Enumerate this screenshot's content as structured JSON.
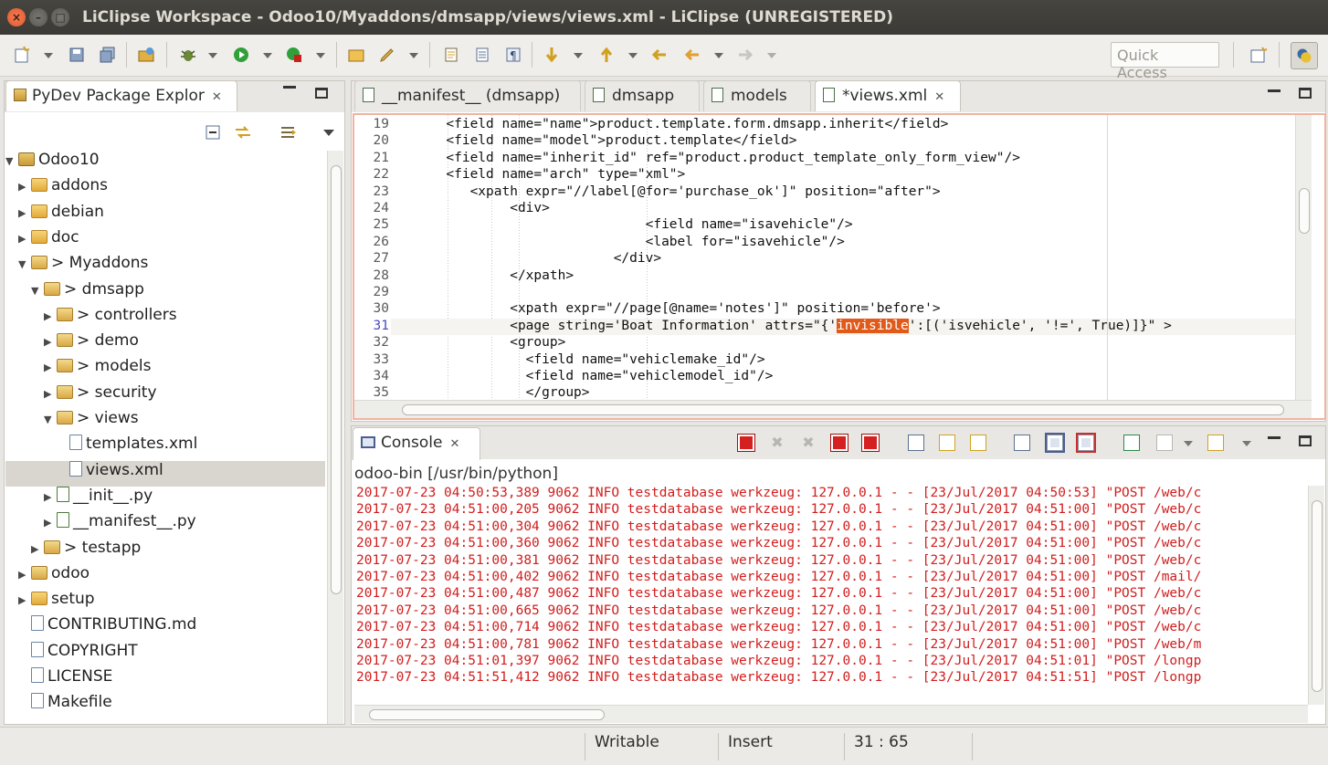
{
  "window": {
    "title": "LiClipse Workspace - Odoo10/Myaddons/dmsapp/views/views.xml - LiClipse (UNREGISTERED)",
    "close_glyph": "×",
    "min_glyph": "–",
    "max_glyph": "□"
  },
  "toolbar": {
    "quick_access_placeholder": "Quick Access"
  },
  "explorer": {
    "tab_label": "PyDev Package Explor",
    "tree": [
      {
        "label": "Odoo10",
        "arrow": "▼",
        "icon": "project",
        "indent": 0
      },
      {
        "label": "addons",
        "arrow": "▶",
        "icon": "folder",
        "indent": 1
      },
      {
        "label": "debian",
        "arrow": "▶",
        "icon": "folder",
        "indent": 1
      },
      {
        "label": "doc",
        "arrow": "▶",
        "icon": "folder",
        "indent": 1
      },
      {
        "label": "> Myaddons",
        "arrow": "▼",
        "icon": "pkg",
        "indent": 1
      },
      {
        "label": "> dmsapp",
        "arrow": "▼",
        "icon": "pkg",
        "indent": 2
      },
      {
        "label": "> controllers",
        "arrow": "▶",
        "icon": "pkg",
        "indent": 3
      },
      {
        "label": "> demo",
        "arrow": "▶",
        "icon": "pkg",
        "indent": 3
      },
      {
        "label": "> models",
        "arrow": "▶",
        "icon": "pkg",
        "indent": 3
      },
      {
        "label": "> security",
        "arrow": "▶",
        "icon": "pkg",
        "indent": 3
      },
      {
        "label": "> views",
        "arrow": "▼",
        "icon": "pkg",
        "indent": 3
      },
      {
        "label": "templates.xml",
        "arrow": "",
        "icon": "file",
        "indent": 4
      },
      {
        "label": "views.xml",
        "arrow": "",
        "icon": "file",
        "indent": 4,
        "selected": true
      },
      {
        "label": "__init__.py",
        "arrow": "▶",
        "icon": "py",
        "indent": 3
      },
      {
        "label": "__manifest__.py",
        "arrow": "▶",
        "icon": "py",
        "indent": 3
      },
      {
        "label": "> testapp",
        "arrow": "▶",
        "icon": "pkg",
        "indent": 2
      },
      {
        "label": "odoo",
        "arrow": "▶",
        "icon": "pkg",
        "indent": 1
      },
      {
        "label": "setup",
        "arrow": "▶",
        "icon": "folder",
        "indent": 1
      },
      {
        "label": "CONTRIBUTING.md",
        "arrow": "",
        "icon": "file",
        "indent": 1
      },
      {
        "label": "COPYRIGHT",
        "arrow": "",
        "icon": "file",
        "indent": 1
      },
      {
        "label": "LICENSE",
        "arrow": "",
        "icon": "file",
        "indent": 1
      },
      {
        "label": "Makefile",
        "arrow": "",
        "icon": "file",
        "indent": 1
      }
    ]
  },
  "editor": {
    "tabs": [
      {
        "label": "__manifest__ (dmsapp)",
        "active": false
      },
      {
        "label": "dmsapp",
        "active": false
      },
      {
        "label": "models",
        "active": false
      },
      {
        "label": "*views.xml",
        "active": true
      }
    ],
    "lines": [
      {
        "n": "19",
        "code": "      <field name=\"name\">product.template.form.dmsapp.inherit</field>"
      },
      {
        "n": "20",
        "code": "      <field name=\"model\">product.template</field>"
      },
      {
        "n": "21",
        "code": "      <field name=\"inherit_id\" ref=\"product.product_template_only_form_view\"/>"
      },
      {
        "n": "22",
        "code": "      <field name=\"arch\" type=\"xml\">"
      },
      {
        "n": "23",
        "code": "         <xpath expr=\"//label[@for='purchase_ok']\" position=\"after\">"
      },
      {
        "n": "24",
        "code": "              <div>"
      },
      {
        "n": "25",
        "code": "                               <field name=\"isavehicle\"/>"
      },
      {
        "n": "26",
        "code": "                               <label for=\"isavehicle\"/>"
      },
      {
        "n": "27",
        "code": "                           </div>"
      },
      {
        "n": "28",
        "code": "              </xpath>"
      },
      {
        "n": "29",
        "code": ""
      },
      {
        "n": "30",
        "code": "              <xpath expr=\"//page[@name='notes']\" position='before'>"
      },
      {
        "n": "31",
        "code_pre": "              <page string='Boat Information' attrs=\"{'",
        "code_hl": "invisible",
        "code_post": "':[('isvehicle', '!=', True)]}\" >",
        "current": true
      },
      {
        "n": "32",
        "code": "              <group>"
      },
      {
        "n": "33",
        "code": "                <field name=\"vehiclemake_id\"/>"
      },
      {
        "n": "34",
        "code": "                <field name=\"vehiclemodel_id\"/>"
      },
      {
        "n": "35",
        "code": "                </group>"
      }
    ]
  },
  "console": {
    "tab_label": "Console",
    "process": "odoo-bin [/usr/bin/python]",
    "lines": [
      "2017-07-23 04:50:53,389 9062 INFO testdatabase werkzeug: 127.0.0.1 - - [23/Jul/2017 04:50:53] \"POST /web/c",
      "2017-07-23 04:51:00,205 9062 INFO testdatabase werkzeug: 127.0.0.1 - - [23/Jul/2017 04:51:00] \"POST /web/c",
      "2017-07-23 04:51:00,304 9062 INFO testdatabase werkzeug: 127.0.0.1 - - [23/Jul/2017 04:51:00] \"POST /web/c",
      "2017-07-23 04:51:00,360 9062 INFO testdatabase werkzeug: 127.0.0.1 - - [23/Jul/2017 04:51:00] \"POST /web/c",
      "2017-07-23 04:51:00,381 9062 INFO testdatabase werkzeug: 127.0.0.1 - - [23/Jul/2017 04:51:00] \"POST /web/c",
      "2017-07-23 04:51:00,402 9062 INFO testdatabase werkzeug: 127.0.0.1 - - [23/Jul/2017 04:51:00] \"POST /mail/",
      "2017-07-23 04:51:00,487 9062 INFO testdatabase werkzeug: 127.0.0.1 - - [23/Jul/2017 04:51:00] \"POST /web/c",
      "2017-07-23 04:51:00,665 9062 INFO testdatabase werkzeug: 127.0.0.1 - - [23/Jul/2017 04:51:00] \"POST /web/c",
      "2017-07-23 04:51:00,714 9062 INFO testdatabase werkzeug: 127.0.0.1 - - [23/Jul/2017 04:51:00] \"POST /web/c",
      "2017-07-23 04:51:00,781 9062 INFO testdatabase werkzeug: 127.0.0.1 - - [23/Jul/2017 04:51:00] \"POST /web/m",
      "2017-07-23 04:51:01,397 9062 INFO testdatabase werkzeug: 127.0.0.1 - - [23/Jul/2017 04:51:01] \"POST /longp",
      "2017-07-23 04:51:51,412 9062 INFO testdatabase werkzeug: 127.0.0.1 - - [23/Jul/2017 04:51:51] \"POST /longp"
    ]
  },
  "status": {
    "writable": "Writable",
    "mode": "Insert",
    "position": "31 : 65"
  },
  "colors": {
    "console_text": "#d21d1d",
    "highlight": "#e05a1a",
    "editor_border": "#f2b3a0"
  }
}
